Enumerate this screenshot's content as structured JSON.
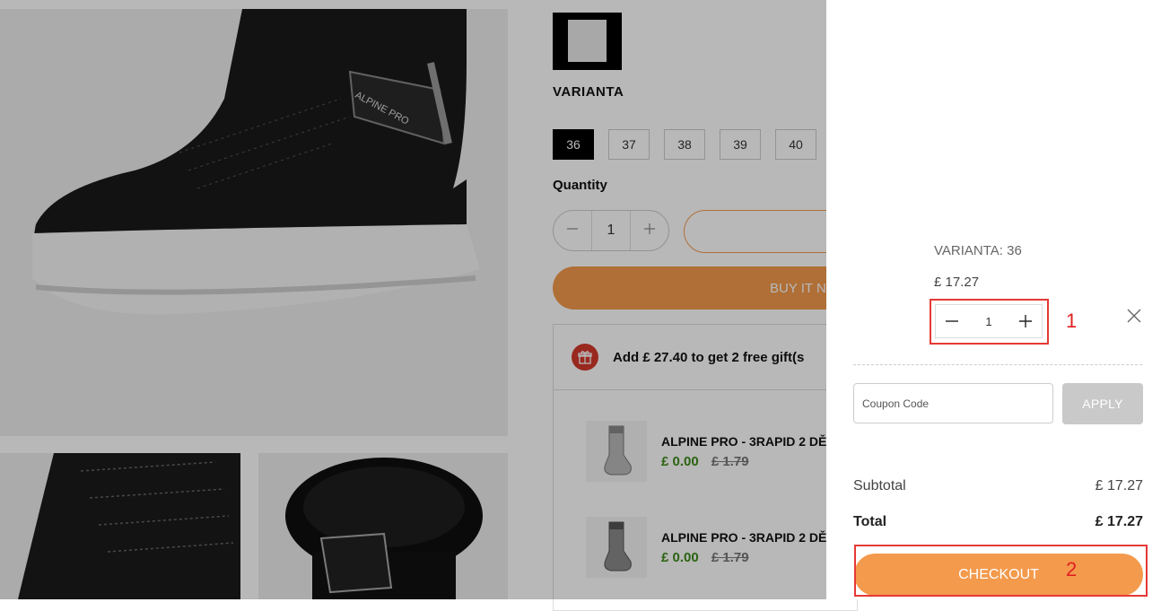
{
  "product": {
    "varianta_label": "VARIANTA",
    "sizes": [
      "36",
      "37",
      "38",
      "39",
      "40"
    ],
    "selected_size": "36",
    "quantity_label": "Quantity",
    "quantity_value": "1",
    "buy_now_label": "BUY IT NO",
    "brand_logo": "ALPINE PRO"
  },
  "gift_offer": {
    "message": "Add £ 27.40 to get 2 free gift(s",
    "items": [
      {
        "name": "ALPINE PRO - 3RAPID 2 DĚ",
        "price_new": "£ 0.00",
        "price_old": "£ 1.79"
      },
      {
        "name": "ALPINE PRO - 3RAPID 2 DĚ",
        "price_new": "£ 0.00",
        "price_old": "£ 1.79"
      }
    ]
  },
  "cart": {
    "variant": "VARIANTA: 36",
    "unit_price": "£ 17.27",
    "quantity": "1",
    "coupon_placeholder": "Coupon Code",
    "apply_label": "APPLY",
    "subtotal_label": "Subtotal",
    "subtotal_value": "£ 17.27",
    "total_label": "Total",
    "total_value": "£ 17.27",
    "checkout_label": "CHECKOUT"
  },
  "annotations": {
    "label_1": "1",
    "label_2": "2"
  },
  "colors": {
    "accent": "#f39a4c",
    "annotation": "#e53935",
    "gift_price": "#3c8a18",
    "gift_icon_bg": "#d53a2c"
  }
}
